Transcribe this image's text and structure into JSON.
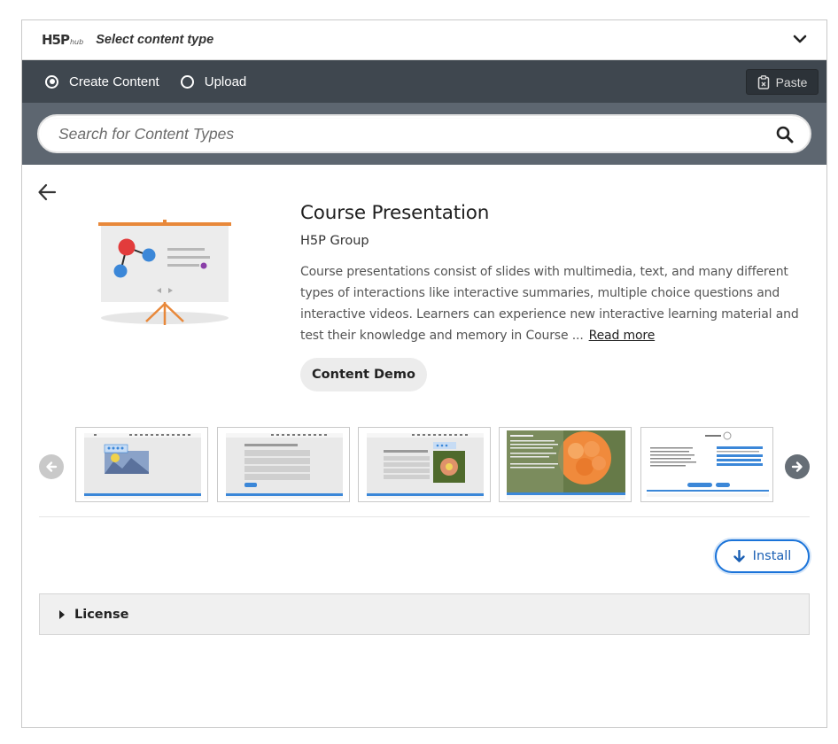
{
  "header": {
    "logo_text": "H5P",
    "logo_sub": "hub",
    "title": "Select content type"
  },
  "tabs": [
    {
      "label": "Create Content",
      "selected": true
    },
    {
      "label": "Upload",
      "selected": false
    }
  ],
  "toolbar": {
    "paste_label": "Paste"
  },
  "search": {
    "placeholder": "Search for Content Types"
  },
  "detail": {
    "title": "Course Presentation",
    "owner": "H5P Group",
    "description": "Course presentations consist of slides with multimedia, text, and many different types of interactions like interactive summaries, multiple choice questions and interactive videos. Learners can experience new interactive learning material and test their knowledge and memory in Course ...",
    "read_more": "Read more",
    "demo_label": "Content Demo",
    "install_label": "Install"
  },
  "screenshots": [
    {
      "name": "slide-image-editing"
    },
    {
      "name": "slide-quiz-options"
    },
    {
      "name": "slide-flower-question"
    },
    {
      "name": "slide-cloudberries"
    },
    {
      "name": "slide-summary-score"
    }
  ],
  "license": {
    "label": "License"
  },
  "colors": {
    "tabbar": "#3f474f",
    "search_bg": "#5d6670",
    "accent": "#1a73d9",
    "illustration_orange": "#e8883a",
    "illustration_red": "#e23c3c",
    "illustration_blue": "#3b87d8"
  }
}
